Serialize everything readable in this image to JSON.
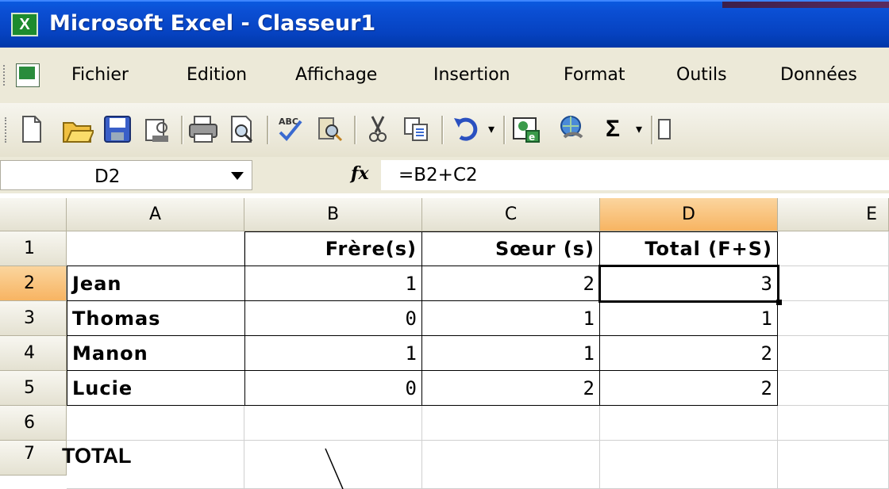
{
  "window": {
    "title": "Microsoft Excel - Classeur1"
  },
  "menu": {
    "items": [
      "Fichier",
      "Edition",
      "Affichage",
      "Insertion",
      "Format",
      "Outils",
      "Données"
    ]
  },
  "toolbar": {
    "buttons": [
      "new-icon",
      "open-icon",
      "save-icon",
      "permission-icon",
      "print-icon",
      "print-preview-icon",
      "spelling-icon",
      "research-icon",
      "cut-icon",
      "copy-icon",
      "undo-icon",
      "insert-hyperlink-icon",
      "autosum-icon"
    ],
    "autosum_label": "Σ"
  },
  "formula_bar": {
    "name_box": "D2",
    "fx_label": "fx",
    "formula": "=B2+C2"
  },
  "sheet": {
    "columns": [
      "A",
      "B",
      "C",
      "D",
      "E"
    ],
    "row_numbers": [
      "1",
      "2",
      "3",
      "4",
      "5",
      "6",
      "7"
    ],
    "active_cell": "D2",
    "headers": {
      "b": "Frère(s)",
      "c": "Sœur (s)",
      "d": "Total (F+S)"
    },
    "rows": [
      {
        "name": "Jean",
        "freres": "1",
        "soeurs": "2",
        "total": "3"
      },
      {
        "name": "Thomas",
        "freres": "0",
        "soeurs": "1",
        "total": "1"
      },
      {
        "name": "Manon",
        "freres": "1",
        "soeurs": "1",
        "total": "2"
      },
      {
        "name": "Lucie",
        "freres": "0",
        "soeurs": "2",
        "total": "2"
      }
    ],
    "total_label": "TOTAL"
  }
}
